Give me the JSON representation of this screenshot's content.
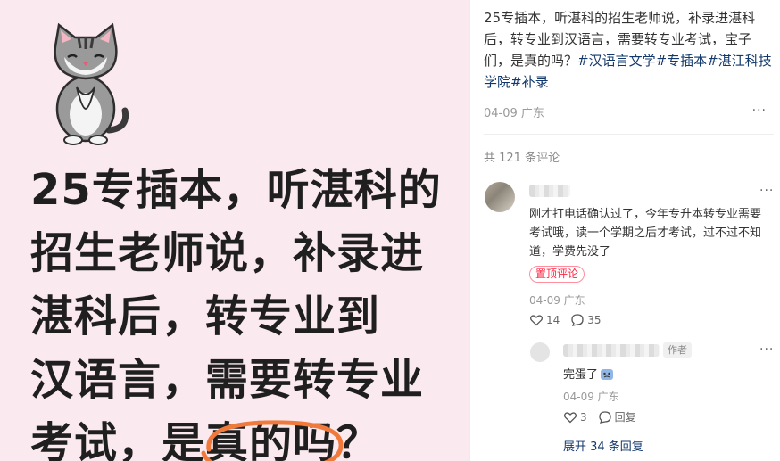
{
  "image": {
    "headline_lines": [
      "25专插本，听湛科的",
      "招生老师说，补录进",
      "湛科后，转专业到",
      "汉语言，需要转专业"
    ],
    "last_line_prefix": "考试，是",
    "last_line_highlight": "真的吗",
    "last_line_suffix": "？",
    "circle_color": "#f07a3c"
  },
  "post": {
    "body": "25专插本，听湛科的招生老师说，补录进湛科后，转专业到汉语言，需要转专业考试，宝子们，是真的吗？",
    "tags": [
      "#汉语言文学",
      "#专插本",
      "#湛江科技学院",
      "#补录"
    ],
    "date": "04-09 广东",
    "more": "···"
  },
  "comments_header": "共 121 条评论",
  "comment1": {
    "text": "刚才打电话确认过了，今年专升本转专业需要考试哦，读一个学期之后才考试，过不过不知道，学费先没了",
    "badge": "置顶评论",
    "date": "04-09 广东",
    "likes": "14",
    "replies": "35",
    "more": "···"
  },
  "reply1": {
    "author_badge": "作者",
    "text": "完蛋了",
    "date": "04-09 广东",
    "likes": "3",
    "reply_label": "回复",
    "more": "···"
  },
  "expand_label": "展开 34 条回复",
  "colors": {
    "tag": "#13386c",
    "pin": "#ff2442",
    "bg_image": "#fbe9f0"
  }
}
